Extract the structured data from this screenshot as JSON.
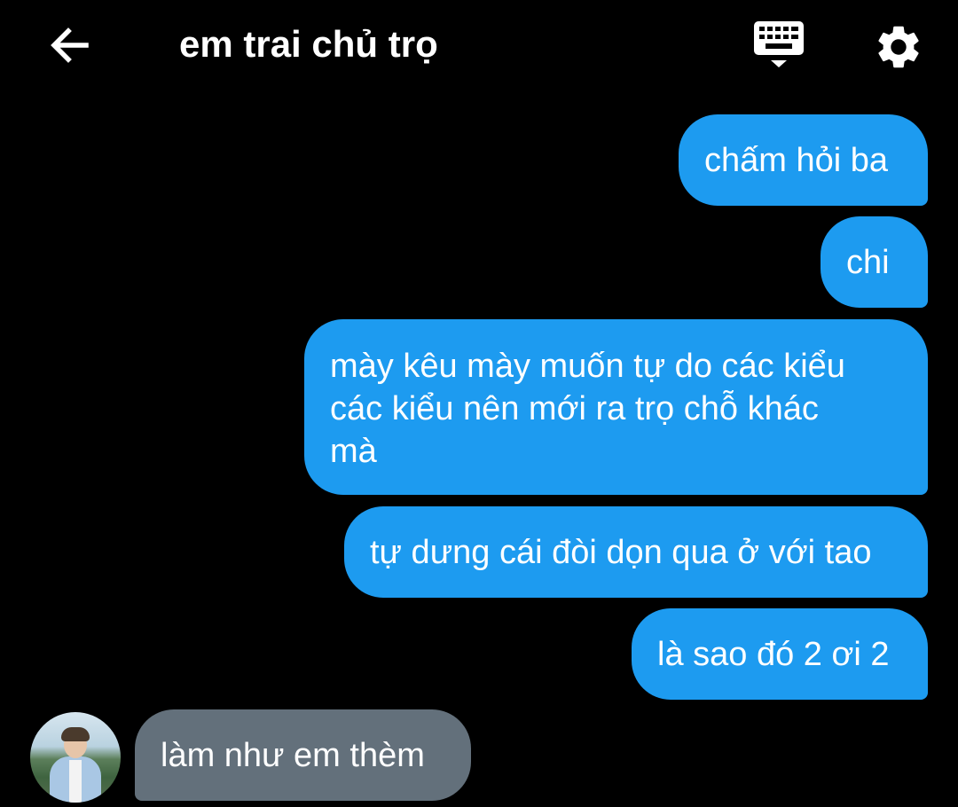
{
  "header": {
    "title": "em trai chủ trọ",
    "back_icon": "arrow-left-icon",
    "keyboard_icon": "keyboard-hide-icon",
    "settings_icon": "gear-icon"
  },
  "colors": {
    "background": "#000000",
    "sent_bubble": "#1d9bf0",
    "received_bubble": "#63707b",
    "text": "#ffffff"
  },
  "messages": [
    {
      "direction": "sent",
      "lines": [
        "chấm hỏi ba"
      ]
    },
    {
      "direction": "sent",
      "lines": [
        "chi"
      ]
    },
    {
      "direction": "sent",
      "lines": [
        "mày kêu mày muốn tự do các kiểu",
        "các kiểu nên mới ra trọ chỗ khác",
        "mà"
      ]
    },
    {
      "direction": "sent",
      "lines": [
        "tự dưng cái đòi dọn qua ở với tao"
      ]
    },
    {
      "direction": "sent",
      "lines": [
        "là sao đó 2 ơi 2"
      ]
    },
    {
      "direction": "received",
      "lines": [
        "làm như em thèm"
      ]
    }
  ]
}
